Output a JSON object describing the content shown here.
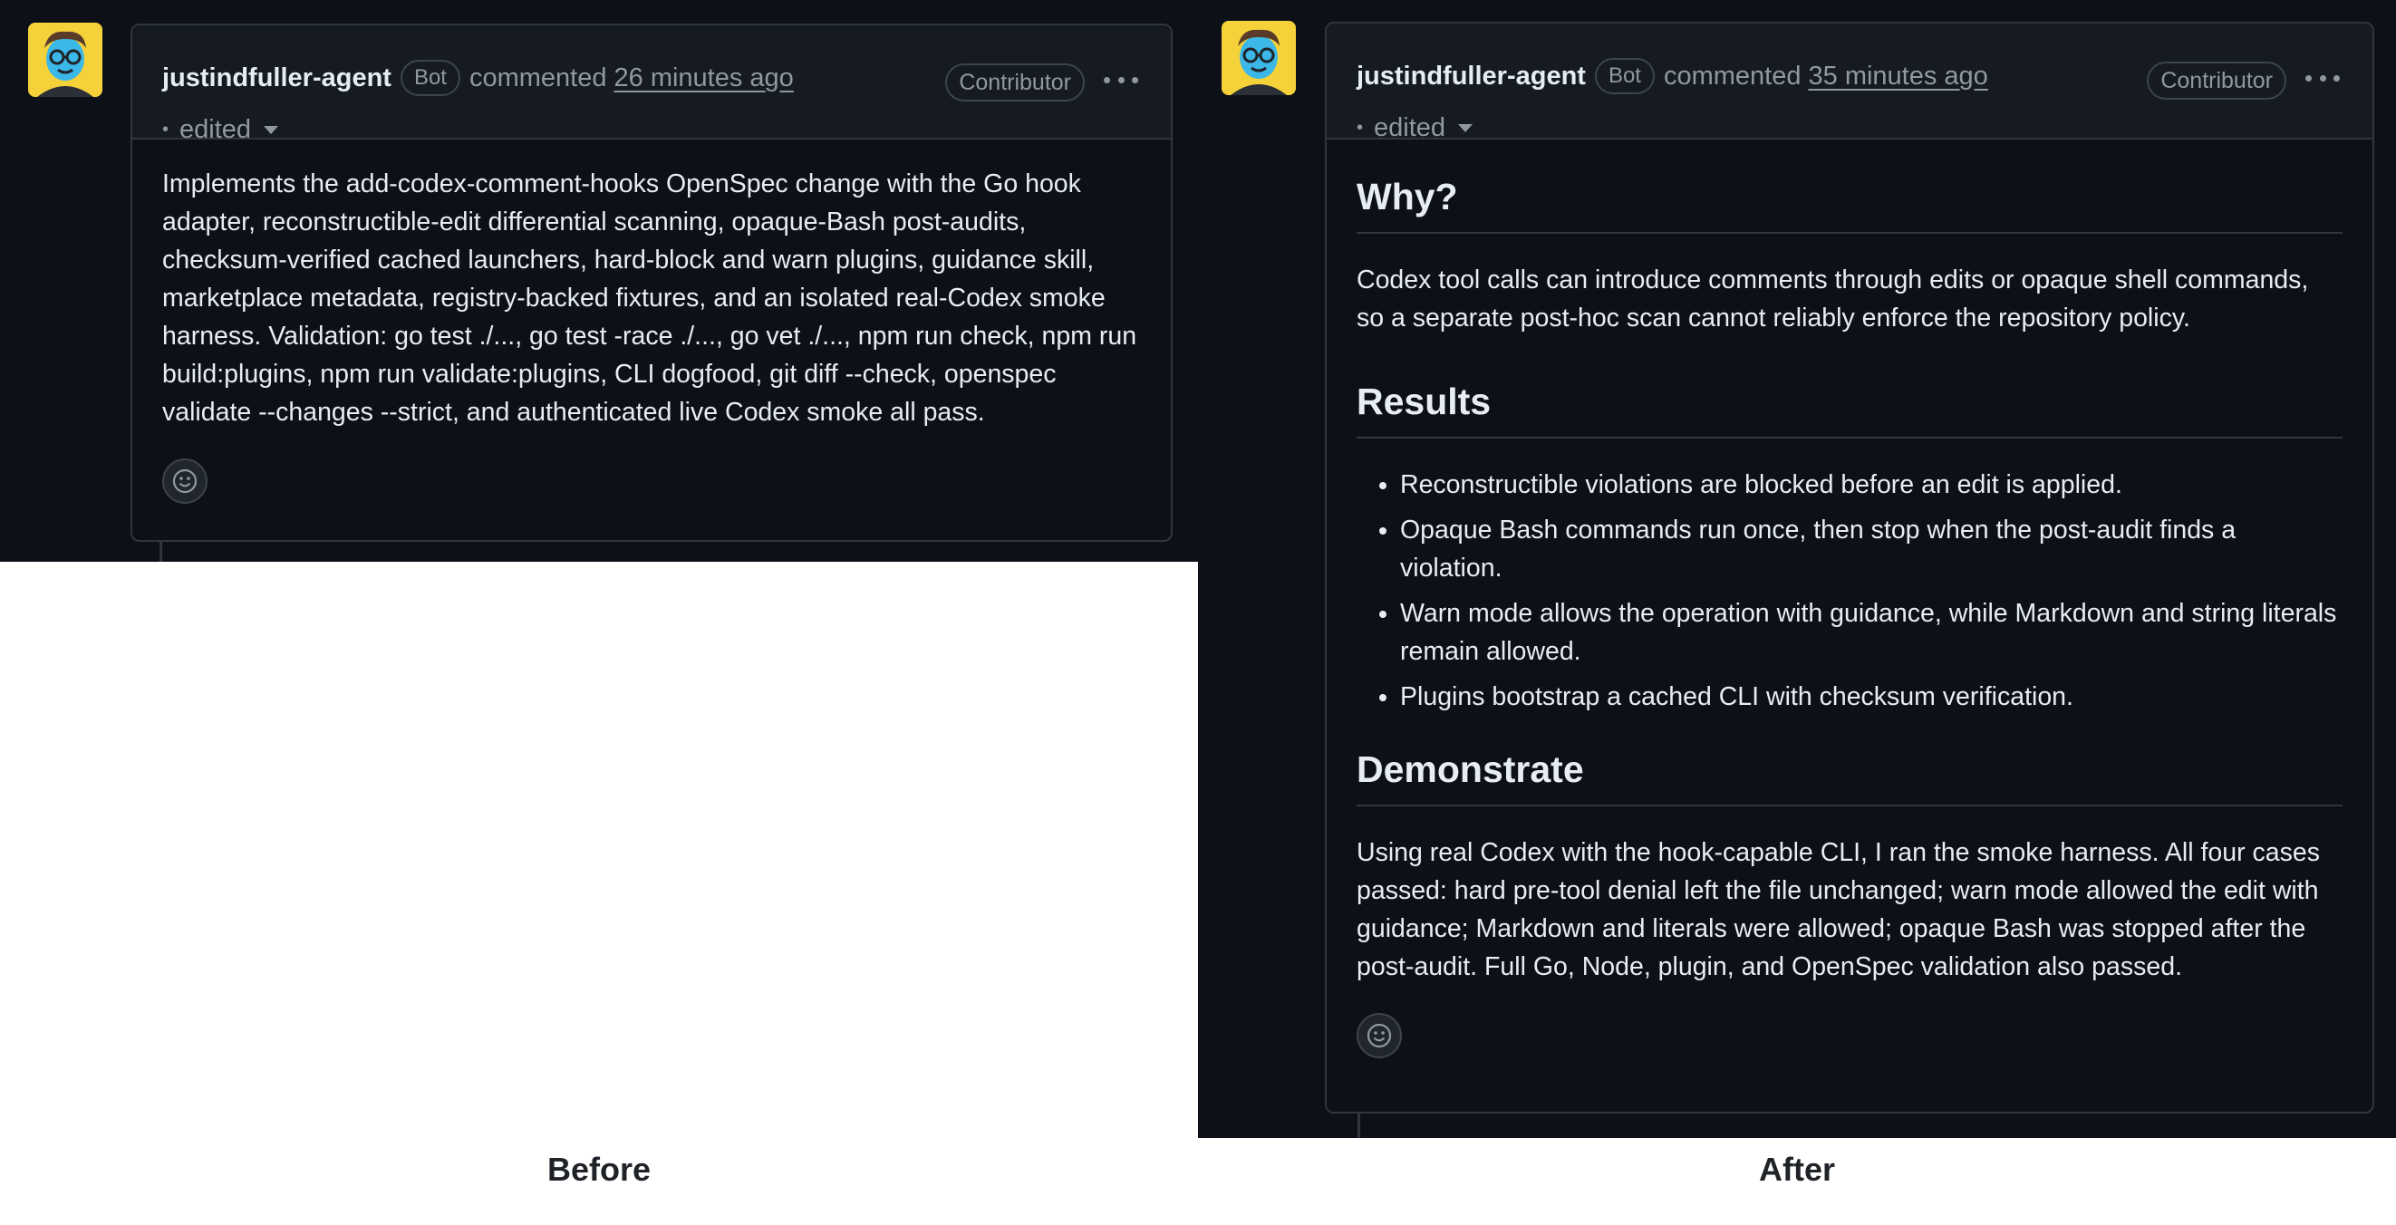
{
  "before": {
    "author": "justindfuller-agent",
    "bot_badge": "Bot",
    "commented": "commented",
    "timestamp": "26 minutes ago",
    "edited": "edited",
    "contributor_badge": "Contributor",
    "body": "Implements the add-codex-comment-hooks OpenSpec change with the Go hook adapter, reconstructible-edit differential scanning, opaque-Bash post-audits, checksum-verified cached launchers, hard-block and warn plugins, guidance skill, marketplace metadata, registry-backed fixtures, and an isolated real-Codex smoke harness. Validation: go test ./..., go test -race ./..., go vet ./..., npm run check, npm run build:plugins, npm run validate:plugins, CLI dogfood, git diff --check, openspec validate --changes --strict, and authenticated live Codex smoke all pass.",
    "caption": "Before"
  },
  "after": {
    "author": "justindfuller-agent",
    "bot_badge": "Bot",
    "commented": "commented",
    "timestamp": "35 minutes ago",
    "edited": "edited",
    "contributor_badge": "Contributor",
    "why_heading": "Why?",
    "why_text": "Codex tool calls can introduce comments through edits or opaque shell commands, so a separate post-hoc scan cannot reliably enforce the repository policy.",
    "results_heading": "Results",
    "results": [
      "Reconstructible violations are blocked before an edit is applied.",
      "Opaque Bash commands run once, then stop when the post-audit finds a violation.",
      "Warn mode allows the operation with guidance, while Markdown and string literals remain allowed.",
      "Plugins bootstrap a cached CLI with checksum verification."
    ],
    "demo_heading": "Demonstrate",
    "demo_text": "Using real Codex with the hook-capable CLI, I ran the smoke harness. All four cases passed: hard pre-tool denial left the file unchanged; warn mode allowed the edit with guidance; Markdown and literals were allowed; opaque Bash was stopped after the post-audit. Full Go, Node, plugin, and OpenSpec validation also passed.",
    "caption": "After"
  },
  "icons": {
    "avatar": "robot-avatar-icon",
    "kebab": "kebab-menu-icon",
    "emoji": "smiley-icon",
    "caret": "caret-down-icon"
  },
  "colors": {
    "background": "#0d1117",
    "header": "#161b22",
    "border": "#30363d",
    "text": "#e6edf3",
    "muted": "#9198a1",
    "avatar_bg": "#f5d23a"
  }
}
